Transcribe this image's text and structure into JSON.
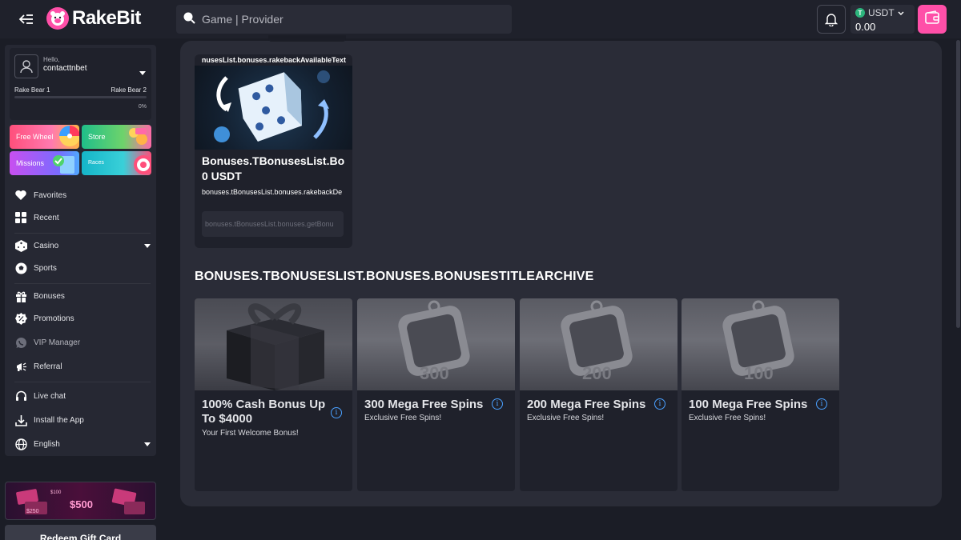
{
  "header": {
    "brand": "RakeBit",
    "search_placeholder": "Game | Provider",
    "currency": "USDT",
    "balance": "0.00"
  },
  "user": {
    "greeting": "Hello,",
    "username": "contacttnbet",
    "level_current": "Rake Bear 1",
    "level_next": "Rake Bear 2",
    "progress_label": "0%",
    "progress": 0
  },
  "promos": {
    "free_wheel": "Free Wheel",
    "store": "Store",
    "missions": "Missions",
    "races": "Races"
  },
  "nav": {
    "favorites": "Favorites",
    "recent": "Recent",
    "casino": "Casino",
    "sports": "Sports",
    "bonuses": "Bonuses",
    "promotions": "Promotions",
    "vip_manager": "VIP Manager",
    "referral": "Referral",
    "live_chat": "Live chat",
    "install_app": "Install the App",
    "language": "English"
  },
  "giftcard": {
    "amount": "$500",
    "small_amount": "$250",
    "small_amount2": "$100",
    "redeem_label": "Redeem Gift Card"
  },
  "rakeback": {
    "available_text": "nusesList.bonuses.rakebackAvailableText",
    "title": "Bonuses.TBonusesList.Bo",
    "value": "0 USDT",
    "description": "bonuses.tBonusesList.bonuses.rakebackDe",
    "button": "bonuses.tBonusesList.bonuses.getBonu"
  },
  "archive": {
    "title": "BONUSES.TBONUSESLIST.BONUSES.BONUSESTITLEARCHIVE",
    "cards": [
      {
        "title": "100% Cash Bonus Up To $4000",
        "subtitle": "Your First Welcome Bonus!",
        "image_text": ""
      },
      {
        "title": "300 Mega Free Spins",
        "subtitle": "Exclusive Free Spins!",
        "image_text": "300"
      },
      {
        "title": "200 Mega Free Spins",
        "subtitle": "Exclusive Free Spins!",
        "image_text": "200"
      },
      {
        "title": "100 Mega Free Spins",
        "subtitle": "Exclusive Free Spins!",
        "image_text": "100"
      }
    ]
  },
  "colors": {
    "accent": "#ff4fa8",
    "background": "#1b1d26",
    "panel": "#2a2c37",
    "card": "#1f212b",
    "info": "#4aa0ff"
  }
}
